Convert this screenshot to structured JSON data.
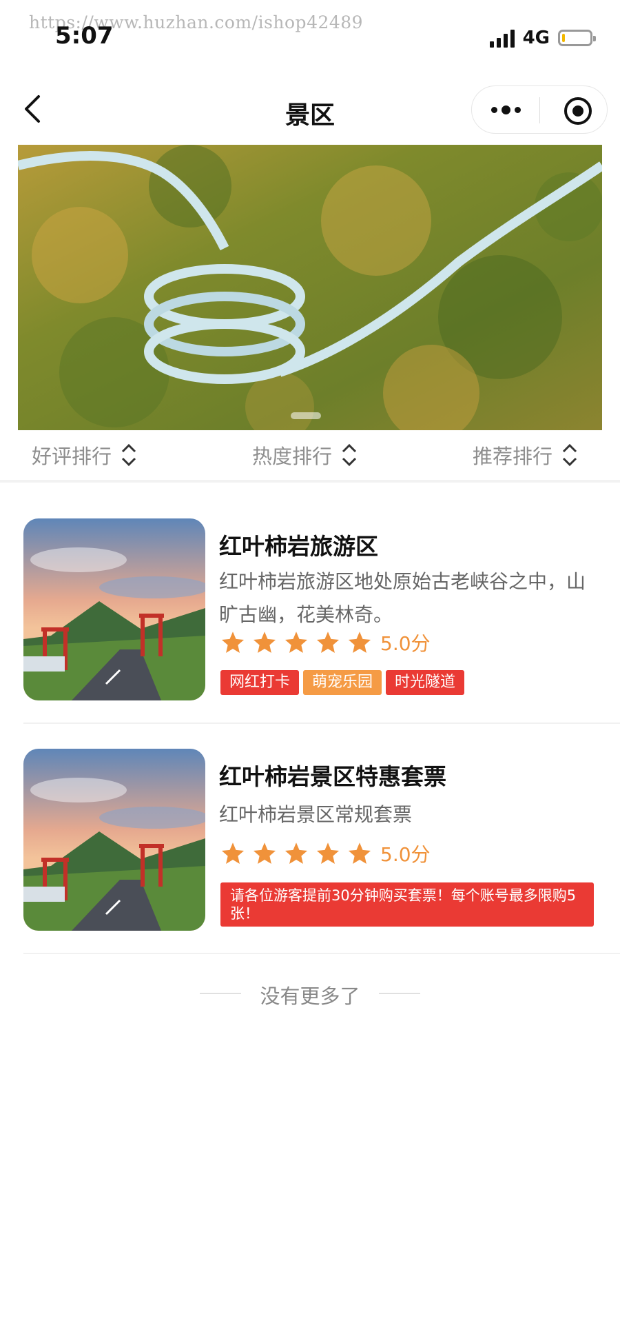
{
  "watermark": "https://www.huzhan.com/ishop42489",
  "status_bar": {
    "time": "5:07",
    "network": "4G"
  },
  "nav": {
    "title": "景区",
    "back_icon": "back-chevron-icon",
    "more_icon": "more-dots-icon",
    "close_icon": "target-close-icon"
  },
  "banner": {
    "image": "glass-slide-scenery-photo",
    "slide_indicator": "carousel-dot"
  },
  "sort_bar": {
    "items": [
      {
        "label": "好评排行",
        "icon": "sort-arrows-icon"
      },
      {
        "label": "热度排行",
        "icon": "sort-arrows-icon"
      },
      {
        "label": "推荐排行",
        "icon": "sort-arrows-icon"
      }
    ]
  },
  "listings": [
    {
      "title": "红叶柿岩旅游区",
      "description": "红叶柿岩旅游区地处原始古老峡谷之中，山旷古幽，花美林奇。",
      "stars": 5,
      "score": "5.0分",
      "tags": [
        {
          "label": "网红打卡",
          "color": "#ea3a34"
        },
        {
          "label": "萌宠乐园",
          "color": "#f59b45"
        },
        {
          "label": "时光隧道",
          "color": "#ea3a34"
        }
      ]
    },
    {
      "title": "红叶柿岩景区特惠套票",
      "description": "红叶柿岩景区常规套票",
      "stars": 5,
      "score": "5.0分",
      "notice": "请各位游客提前30分钟购买套票！每个账号最多限购5张！"
    }
  ],
  "footer": {
    "end_text": "没有更多了"
  },
  "colors": {
    "accent_red": "#ea3a34",
    "accent_orange": "#f59b45",
    "star": "#f0923a"
  }
}
